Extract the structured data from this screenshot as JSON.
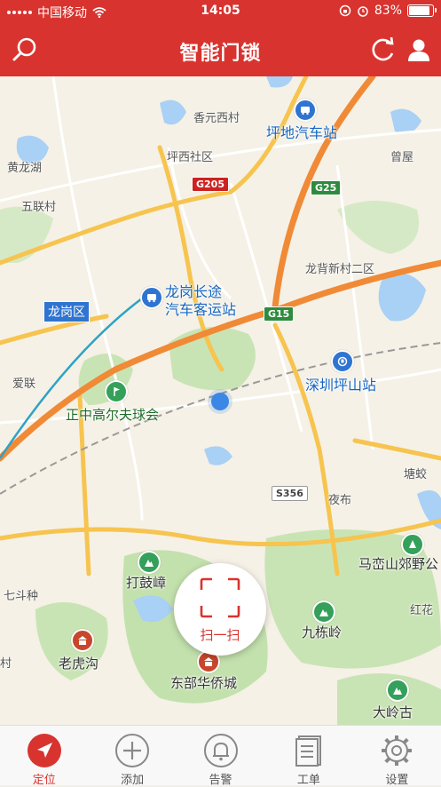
{
  "status_bar": {
    "carrier": "中国移动",
    "time": "14:05",
    "battery": "83%",
    "battery_level": 0.83
  },
  "nav": {
    "title": "智能门锁",
    "icons": {
      "left": "search-icon",
      "right_1": "refresh-icon",
      "right_2": "user-icon"
    }
  },
  "map": {
    "labels": {
      "huanglong_lake": "黄龙湖",
      "xiangyuanxi_village": "香元西村",
      "pingxi_community": "坪西社区",
      "pingdi_bus_station": "坪地汽车站",
      "zengwu": "曾屋",
      "wulian_village": "五联村",
      "longbei_new_village": "龙背新村二区",
      "longgang_district": "龙岗区",
      "longgang_bus_station_line1": "龙岗长途",
      "longgang_bus_station_line2": "汽车客运站",
      "ailian": "爱联",
      "golf_club": "正中高尔夫球会",
      "shenzhen_pingshan_station": "深圳坪山站",
      "tangjiao": "塘蛟",
      "yebu": "夜布",
      "dagu_zhang": "打鼓嶂",
      "qidouzhong": "七斗种",
      "maluanshan_park": "马峦山郊野公",
      "jiudongling": "九栋岭",
      "honghua": "红花",
      "laohu_gou": "老虎沟",
      "village_edge": "村",
      "dongbu_overseas_city": "东部华侨城",
      "daling_gu": "大岭古"
    },
    "shields": {
      "g205": "G205",
      "g25": "G25",
      "g15": "G15",
      "s356": "S356"
    },
    "colors": {
      "expressway": "#f08a36",
      "highway": "#f6c44f",
      "water": "#a9d0f5",
      "park": "#c6e3b0",
      "accent": "#d9332f"
    }
  },
  "scan_button": {
    "label": "扫一扫",
    "icon": "scan-frame-icon"
  },
  "tabs": [
    {
      "label": "定位",
      "icon": "location-arrow-icon",
      "active": true
    },
    {
      "label": "添加",
      "icon": "plus-circle-icon",
      "active": false
    },
    {
      "label": "告警",
      "icon": "bell-icon",
      "active": false
    },
    {
      "label": "工单",
      "icon": "work-order-icon",
      "active": false
    },
    {
      "label": "设置",
      "icon": "gear-icon",
      "active": false
    }
  ]
}
